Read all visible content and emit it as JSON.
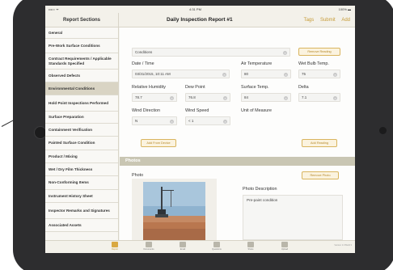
{
  "colors": {
    "accent": "#c69b36",
    "bezel": "#2d2d2f",
    "selected_row": "#d9d4c4",
    "section_bar": "#c9c6b3"
  },
  "statusbar": {
    "left": "••••○ ᯤ",
    "time": "4:31 PM",
    "right": "100% ▬"
  },
  "navbar": {
    "sidebar_title": "Report Sections",
    "title": "Daily Inspection Report #1",
    "actions": [
      "Tags",
      "Submit",
      "Add"
    ]
  },
  "sidebar": {
    "items": [
      {
        "label": "General",
        "active": false
      },
      {
        "label": "Pre-Work Surface Conditions",
        "active": false
      },
      {
        "label": "Contract Requirements / Applicable Standards Specified",
        "active": false
      },
      {
        "label": "Observed Defects",
        "active": false
      },
      {
        "label": "Environmental Conditions",
        "active": true
      },
      {
        "label": "Hold Point Inspections Performed",
        "active": false
      },
      {
        "label": "Surface Preparation",
        "active": false
      },
      {
        "label": "Containment Verification",
        "active": false
      },
      {
        "label": "Painted Surface Condition",
        "active": false
      },
      {
        "label": "Product / Mixing",
        "active": false
      },
      {
        "label": "Wet / Dry Film Thickness",
        "active": false
      },
      {
        "label": "Non-Conforming Items",
        "active": false
      },
      {
        "label": "Instrument History Sheet",
        "active": false
      },
      {
        "label": "Inspector Remarks and Signatures",
        "active": false
      },
      {
        "label": "Associated Assets",
        "active": false
      }
    ]
  },
  "environment": {
    "conditions_value": "Conditions",
    "remove_reading_button": "Remove Reading",
    "fields": {
      "date_time": {
        "label": "Date / Time",
        "value": "03/31/2015, 10:11 AM"
      },
      "air_temperature": {
        "label": "Air Temperature",
        "value": "80"
      },
      "wet_bulb_temp": {
        "label": "Wet Bulb Temp.",
        "value": "75"
      },
      "relative_humidity": {
        "label": "Relative Humidity",
        "value": "78.7"
      },
      "dew_point": {
        "label": "Dew Point",
        "value": "76.8"
      },
      "surface_temp": {
        "label": "Surface Temp.",
        "value": "84"
      },
      "delta": {
        "label": "Delta",
        "value": "7.1"
      },
      "wind_direction": {
        "label": "Wind Direction",
        "value": "N"
      },
      "wind_speed": {
        "label": "Wind Speed",
        "value": "< 1"
      },
      "unit_of_measure": {
        "label": "Unit of Measure",
        "value": ""
      }
    },
    "add_from_device_button": "Add From Device",
    "add_reading_button": "Add Reading"
  },
  "photos": {
    "section_title": "Photos",
    "remove_photo_button": "Remove Photo",
    "photo_label": "Photo",
    "description_label": "Photo Description",
    "description_value": "Pre-paint condition"
  },
  "tabbar": {
    "items": [
      {
        "label": "Report",
        "icon": "report-icon",
        "active": true
      },
      {
        "label": "Documents",
        "icon": "documents-icon",
        "active": false
      },
      {
        "label": "Email",
        "icon": "email-icon",
        "active": false
      },
      {
        "label": "Questions",
        "icon": "questions-icon",
        "active": false
      },
      {
        "label": "Share",
        "icon": "share-icon",
        "active": false
      },
      {
        "label": "Upload",
        "icon": "upload-icon",
        "active": false
      }
    ],
    "version": "Version 2.0 Build 3"
  }
}
